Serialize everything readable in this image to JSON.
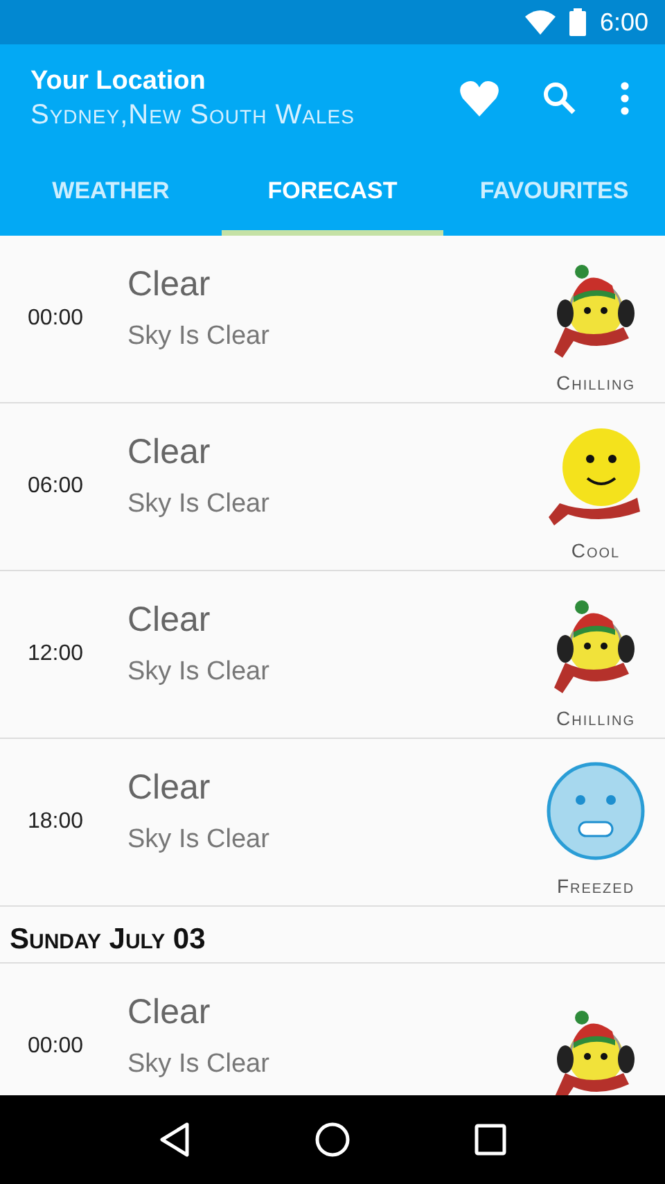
{
  "status_bar": {
    "time": "6:00"
  },
  "toolbar": {
    "title": "Your Location",
    "subtitle": "Sydney,New South Wales"
  },
  "tabs": [
    {
      "label": "WEATHER",
      "selected": false
    },
    {
      "label": "FORECAST",
      "selected": true
    },
    {
      "label": "FAVOURITES",
      "selected": false
    }
  ],
  "groups": [
    {
      "rows": [
        {
          "time": "00:00",
          "title": "Clear",
          "description": "Sky Is Clear",
          "mood": {
            "kind": "chilling",
            "label": "Chilling"
          }
        },
        {
          "time": "06:00",
          "title": "Clear",
          "description": "Sky Is Clear",
          "mood": {
            "kind": "cool",
            "label": "Cool"
          }
        },
        {
          "time": "12:00",
          "title": "Clear",
          "description": "Sky Is Clear",
          "mood": {
            "kind": "chilling",
            "label": "Chilling"
          }
        },
        {
          "time": "18:00",
          "title": "Clear",
          "description": "Sky Is Clear",
          "mood": {
            "kind": "freezed",
            "label": "Freezed"
          }
        }
      ]
    },
    {
      "header": "Sunday July 03",
      "rows": [
        {
          "time": "00:00",
          "title": "Clear",
          "description": "Sky Is Clear",
          "mood": {
            "kind": "chilling"
          }
        }
      ]
    }
  ]
}
